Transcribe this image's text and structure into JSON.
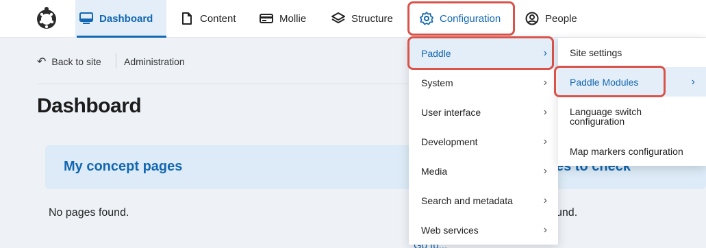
{
  "toolbar": {
    "items": [
      {
        "label": "Dashboard",
        "icon": "monitor-icon"
      },
      {
        "label": "Content",
        "icon": "document-icon"
      },
      {
        "label": "Mollie",
        "icon": "payment-card-icon"
      },
      {
        "label": "Structure",
        "icon": "layers-icon"
      },
      {
        "label": "Configuration",
        "icon": "gear-icon"
      },
      {
        "label": "People",
        "icon": "user-circle-icon"
      }
    ]
  },
  "breadcrumb": {
    "back_label": "Back to site",
    "admin_label": "Administration"
  },
  "page": {
    "title": "Dashboard"
  },
  "cards": [
    {
      "title": "My concept pages",
      "empty_text": "No pages found."
    },
    {
      "title": "es to check",
      "empty_text": "und."
    }
  ],
  "goto_link": "Go to...",
  "config_menu": {
    "items": [
      {
        "label": "Paddle",
        "active": true
      },
      {
        "label": "System"
      },
      {
        "label": "User interface"
      },
      {
        "label": "Development"
      },
      {
        "label": "Media"
      },
      {
        "label": "Search and metadata"
      },
      {
        "label": "Web services"
      }
    ]
  },
  "paddle_menu": {
    "items": [
      {
        "label": "Site settings"
      },
      {
        "label": "Paddle Modules",
        "active": true
      },
      {
        "label": "Language switch configuration"
      },
      {
        "label": "Map markers configuration"
      }
    ]
  },
  "colors": {
    "accent": "#1267b2",
    "highlight_outline": "#d9534a",
    "active_bg": "#e4eef8",
    "page_bg": "#eef2f7"
  }
}
